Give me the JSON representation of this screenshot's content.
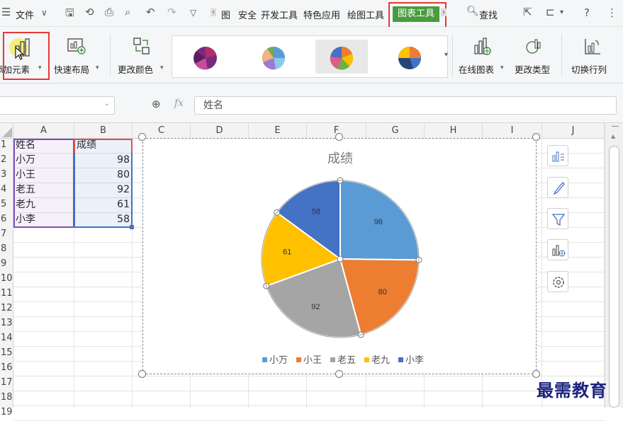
{
  "menubar": {
    "file_label": "文件",
    "tabs": [
      "图",
      "安全",
      "开发工具",
      "特色应用",
      "绘图工具"
    ],
    "active_tab": "图表工具",
    "search_label": "查找",
    "help": "?",
    "more": "⋮"
  },
  "ribbon": {
    "add_element": "添加元素",
    "quick_layout": "快速布局",
    "change_color": "更改颜色",
    "online_chart": "在线图表",
    "change_type": "更改类型",
    "switch_rowcol": "切换行列"
  },
  "formula_bar": {
    "fx": "fx",
    "value": "姓名"
  },
  "columns": [
    "A",
    "B",
    "C",
    "D",
    "E",
    "F",
    "G",
    "H",
    "I",
    "J"
  ],
  "rows": [
    "1",
    "2",
    "3",
    "4",
    "5",
    "6",
    "7",
    "8",
    "9",
    "10",
    "11",
    "12",
    "13",
    "14",
    "15",
    "16",
    "17",
    "18",
    "19"
  ],
  "table": {
    "header": [
      "姓名",
      "成绩"
    ],
    "rows": [
      [
        "小万",
        "98"
      ],
      [
        "小王",
        "80"
      ],
      [
        "老五",
        "92"
      ],
      [
        "老九",
        "61"
      ],
      [
        "小李",
        "58"
      ]
    ]
  },
  "chart_data": {
    "type": "pie",
    "title": "成绩",
    "categories": [
      "小万",
      "小王",
      "老五",
      "老九",
      "小李"
    ],
    "values": [
      98,
      80,
      92,
      61,
      58
    ],
    "colors": [
      "#5b9bd5",
      "#ed7d31",
      "#a5a5a5",
      "#ffc000",
      "#4472c4"
    ],
    "legend": "bottom",
    "data_labels": true
  },
  "watermark": "最需教育",
  "colors": {
    "active_tab": "#4a9b3f",
    "highlight_box": "#e53935",
    "selection_purple": "#7b4fb8",
    "selection_blue": "#4472c4"
  }
}
